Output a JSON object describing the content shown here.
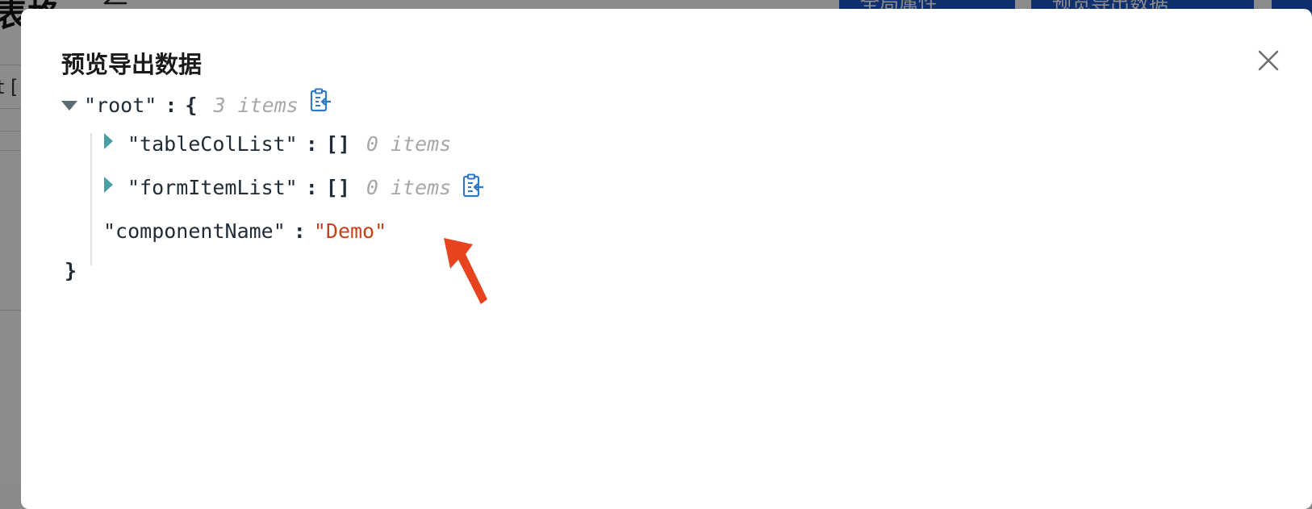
{
  "background": {
    "title": "表格",
    "buttons": [
      "全局属性",
      "预览导出数据",
      ""
    ],
    "tab_text": "t ["
  },
  "modal": {
    "title": "预览导出数据",
    "tree": {
      "root_key": "\"root\"",
      "colon": ":",
      "open_brace": "{",
      "close_brace": "}",
      "root_count": "3 items",
      "items": [
        {
          "key": "\"tableColList\"",
          "value": "[]",
          "count": "0 items"
        },
        {
          "key": "\"formItemList\"",
          "value": "[]",
          "count": "0 items"
        }
      ],
      "component_key": "\"componentName\"",
      "component_value": "\"Demo\""
    }
  },
  "colors": {
    "string_value": "#c7421b",
    "caret_expandable": "#4a9fa6",
    "copy_icon": "#2f78c4",
    "annotation_arrow": "#e8431f",
    "muted_count": "#a8a8a8"
  },
  "icons": {
    "close": "close-icon",
    "copy": "copy-clipboard-icon",
    "caret_expanded": "caret-down-icon",
    "caret_collapsed": "caret-right-icon",
    "annotation": "red-arrow-annotation"
  }
}
